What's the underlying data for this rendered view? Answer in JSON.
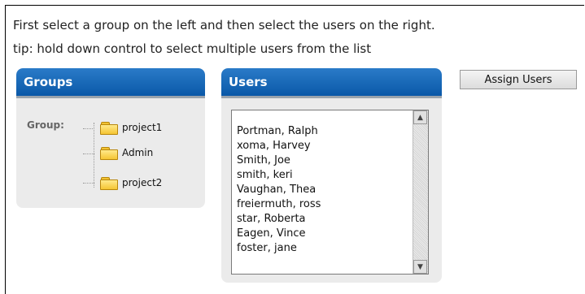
{
  "instructions": {
    "line1": "First select a group on the left and then select the users on the right.",
    "line2": "tip: hold down control to select multiple users from the list"
  },
  "groups_panel": {
    "title": "Groups",
    "group_label": "Group:",
    "items": [
      "project1",
      "Admin",
      "project2"
    ]
  },
  "users_panel": {
    "title": "Users",
    "users": [
      "Portman, Ralph",
      "xoma, Harvey",
      "Smith, Joe",
      "smith, keri",
      "Vaughan, Thea",
      "freiermuth, ross",
      "star, Roberta",
      "Eagen, Vince",
      "foster, jane"
    ],
    "scroll_up": "▲",
    "scroll_down": "▼"
  },
  "assign_button": {
    "label": "Assign Users"
  },
  "colors": {
    "header_top": "#2a7bc8",
    "header_bottom": "#0a58a8",
    "panel_bg": "#ebebeb",
    "folder": "#f5c533"
  }
}
